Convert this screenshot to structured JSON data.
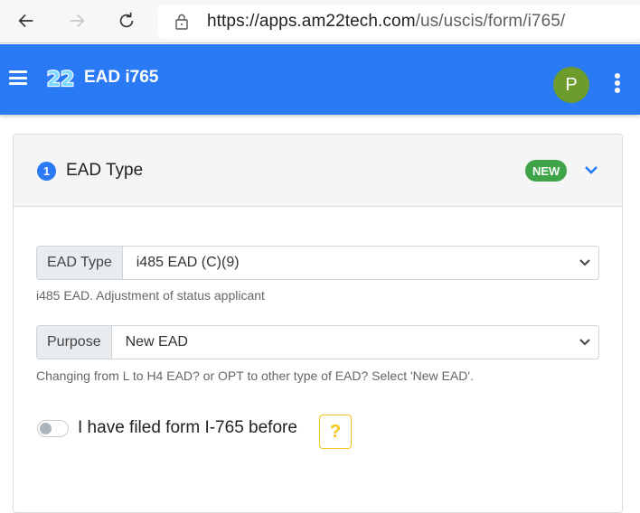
{
  "browser": {
    "url_host": "https://apps.am22tech.com",
    "url_path": "/us/uscis/form/i765/"
  },
  "appbar": {
    "logo_text": "22",
    "title": "EAD i765",
    "avatar_initial": "P",
    "brand_color": "#2a7af6"
  },
  "section": {
    "step_number": "1",
    "title": "EAD Type",
    "badge": "NEW"
  },
  "fields": [
    {
      "label": "EAD Type",
      "selected": "i485 EAD (C)(9)",
      "help": "i485 EAD. Adjustment of status applicant"
    },
    {
      "label": "Purpose",
      "selected": "New EAD",
      "help": "Changing from L to H4 EAD? or OPT to other type of EAD? Select 'New EAD'."
    }
  ],
  "toggle": {
    "label": "I have filed form I-765 before",
    "checked": false,
    "help_button": "?"
  }
}
